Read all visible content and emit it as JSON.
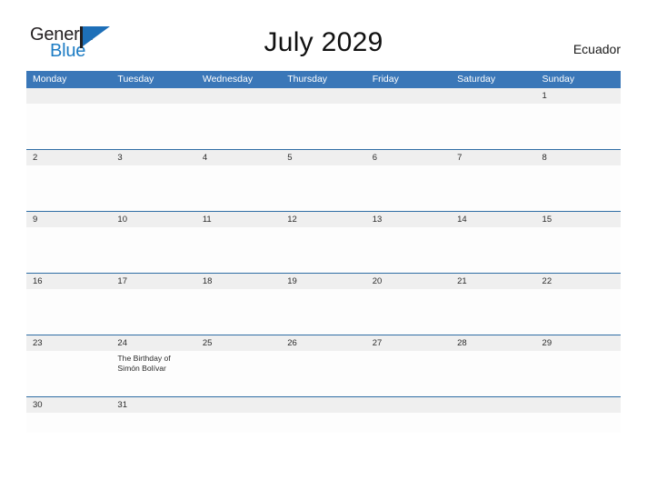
{
  "brand": {
    "name_part1": "General",
    "name_part2": "Blue",
    "flag_icon": "flag-triangle-icon"
  },
  "header": {
    "title": "July 2029",
    "country": "Ecuador"
  },
  "calendar": {
    "weekday_headers": [
      "Monday",
      "Tuesday",
      "Wednesday",
      "Thursday",
      "Friday",
      "Saturday",
      "Sunday"
    ],
    "colors": {
      "header_blue": "#3a77b8",
      "row_divider_blue": "#2e6da4",
      "date_band_gray": "#efefef",
      "brand_blue": "#1d7cc4",
      "text_dark": "#2b2b2b"
    },
    "weeks": [
      {
        "dates": [
          "",
          "",
          "",
          "",
          "",
          "",
          "1"
        ],
        "events": [
          "",
          "",
          "",
          "",
          "",
          "",
          ""
        ]
      },
      {
        "dates": [
          "2",
          "3",
          "4",
          "5",
          "6",
          "7",
          "8"
        ],
        "events": [
          "",
          "",
          "",
          "",
          "",
          "",
          ""
        ]
      },
      {
        "dates": [
          "9",
          "10",
          "11",
          "12",
          "13",
          "14",
          "15"
        ],
        "events": [
          "",
          "",
          "",
          "",
          "",
          "",
          ""
        ]
      },
      {
        "dates": [
          "16",
          "17",
          "18",
          "19",
          "20",
          "21",
          "22"
        ],
        "events": [
          "",
          "",
          "",
          "",
          "",
          "",
          ""
        ]
      },
      {
        "dates": [
          "23",
          "24",
          "25",
          "26",
          "27",
          "28",
          "29"
        ],
        "events": [
          "",
          "The Birthday of Simón Bolívar",
          "",
          "",
          "",
          "",
          ""
        ]
      },
      {
        "dates": [
          "30",
          "31",
          "",
          "",
          "",
          "",
          ""
        ],
        "events": [
          "",
          "",
          "",
          "",
          "",
          "",
          ""
        ]
      }
    ]
  }
}
